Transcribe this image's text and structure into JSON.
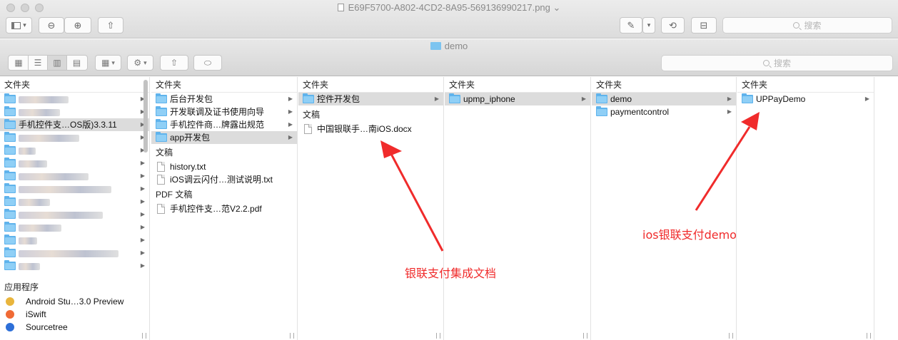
{
  "window": {
    "title": "E69F5700-A802-4CD2-8A95-569136990217.png",
    "title_chevron": "⌄",
    "search_placeholder": "搜索"
  },
  "finder": {
    "title": "demo",
    "search_placeholder": "搜索"
  },
  "columns": [
    {
      "header": "文件夹",
      "folders": [
        {
          "label": "",
          "redacted": true
        },
        {
          "label": "",
          "redacted": true
        },
        {
          "label": "手机控件支…OS版)3.3.11",
          "selected": true
        },
        {
          "label": "",
          "redacted": true
        },
        {
          "label": "",
          "redacted": true
        },
        {
          "label": "",
          "redacted": true
        },
        {
          "label": "",
          "redacted": true
        },
        {
          "label": "",
          "redacted": true
        },
        {
          "label": "",
          "redacted": true
        },
        {
          "label": "",
          "redacted": true
        },
        {
          "label": "",
          "redacted": true
        },
        {
          "label": "",
          "redacted": true
        },
        {
          "label": "",
          "redacted": true
        },
        {
          "label": "",
          "redacted": true
        }
      ],
      "apps_header": "应用程序",
      "apps": [
        {
          "label": "Android Stu…3.0 Preview",
          "icon": "android-studio-icon",
          "color": "#e9b53c"
        },
        {
          "label": "iSwift",
          "icon": "iswift-icon",
          "color": "#f06a35"
        },
        {
          "label": "Sourcetree",
          "icon": "sourcetree-icon",
          "color": "#2d6fd8"
        }
      ]
    },
    {
      "header": "文件夹",
      "folders": [
        {
          "label": "后台开发包"
        },
        {
          "label": "开发联调及证书使用向导"
        },
        {
          "label": "手机控件商…牌露出规范"
        },
        {
          "label": "app开发包",
          "selected": true
        }
      ],
      "docs_header": "文稿",
      "docs": [
        {
          "label": "history.txt"
        },
        {
          "label": "iOS调云闪付…测试说明.txt"
        }
      ],
      "pdf_header": "PDF 文稿",
      "pdfs": [
        {
          "label": "手机控件支…范V2.2.pdf"
        }
      ]
    },
    {
      "header": "文件夹",
      "folders": [
        {
          "label": "控件开发包",
          "selected": true
        }
      ],
      "docs_header": "文稿",
      "docs": [
        {
          "label": "中国银联手…南iOS.docx"
        }
      ]
    },
    {
      "header": "文件夹",
      "folders": [
        {
          "label": "upmp_iphone",
          "selected": true
        }
      ]
    },
    {
      "header": "文件夹",
      "folders": [
        {
          "label": "demo",
          "selected": true
        },
        {
          "label": "paymentcontrol"
        }
      ]
    },
    {
      "header": "文件夹",
      "folders": [
        {
          "label": "UPPayDemo"
        }
      ]
    }
  ],
  "annotations": {
    "left_text": "银联支付集成文档",
    "right_text": "ios银联支付demo",
    "color": "#f02b2b"
  },
  "colors": {
    "folder": "#5fb3ec",
    "selection": "#dcdcdc"
  }
}
